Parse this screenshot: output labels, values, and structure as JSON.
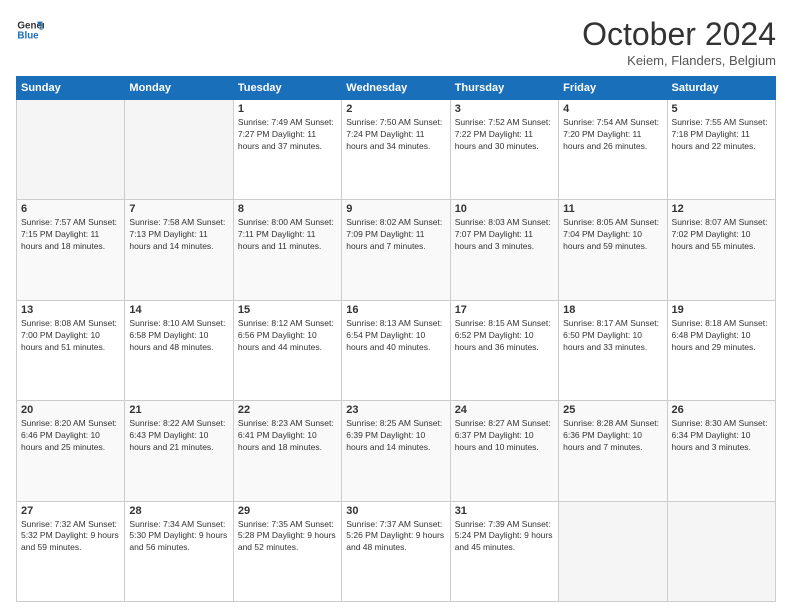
{
  "header": {
    "logo_line1": "General",
    "logo_line2": "Blue",
    "month": "October 2024",
    "location": "Keiem, Flanders, Belgium"
  },
  "weekdays": [
    "Sunday",
    "Monday",
    "Tuesday",
    "Wednesday",
    "Thursday",
    "Friday",
    "Saturday"
  ],
  "weeks": [
    [
      {
        "day": "",
        "info": ""
      },
      {
        "day": "",
        "info": ""
      },
      {
        "day": "1",
        "info": "Sunrise: 7:49 AM\nSunset: 7:27 PM\nDaylight: 11 hours\nand 37 minutes."
      },
      {
        "day": "2",
        "info": "Sunrise: 7:50 AM\nSunset: 7:24 PM\nDaylight: 11 hours\nand 34 minutes."
      },
      {
        "day": "3",
        "info": "Sunrise: 7:52 AM\nSunset: 7:22 PM\nDaylight: 11 hours\nand 30 minutes."
      },
      {
        "day": "4",
        "info": "Sunrise: 7:54 AM\nSunset: 7:20 PM\nDaylight: 11 hours\nand 26 minutes."
      },
      {
        "day": "5",
        "info": "Sunrise: 7:55 AM\nSunset: 7:18 PM\nDaylight: 11 hours\nand 22 minutes."
      }
    ],
    [
      {
        "day": "6",
        "info": "Sunrise: 7:57 AM\nSunset: 7:15 PM\nDaylight: 11 hours\nand 18 minutes."
      },
      {
        "day": "7",
        "info": "Sunrise: 7:58 AM\nSunset: 7:13 PM\nDaylight: 11 hours\nand 14 minutes."
      },
      {
        "day": "8",
        "info": "Sunrise: 8:00 AM\nSunset: 7:11 PM\nDaylight: 11 hours\nand 11 minutes."
      },
      {
        "day": "9",
        "info": "Sunrise: 8:02 AM\nSunset: 7:09 PM\nDaylight: 11 hours\nand 7 minutes."
      },
      {
        "day": "10",
        "info": "Sunrise: 8:03 AM\nSunset: 7:07 PM\nDaylight: 11 hours\nand 3 minutes."
      },
      {
        "day": "11",
        "info": "Sunrise: 8:05 AM\nSunset: 7:04 PM\nDaylight: 10 hours\nand 59 minutes."
      },
      {
        "day": "12",
        "info": "Sunrise: 8:07 AM\nSunset: 7:02 PM\nDaylight: 10 hours\nand 55 minutes."
      }
    ],
    [
      {
        "day": "13",
        "info": "Sunrise: 8:08 AM\nSunset: 7:00 PM\nDaylight: 10 hours\nand 51 minutes."
      },
      {
        "day": "14",
        "info": "Sunrise: 8:10 AM\nSunset: 6:58 PM\nDaylight: 10 hours\nand 48 minutes."
      },
      {
        "day": "15",
        "info": "Sunrise: 8:12 AM\nSunset: 6:56 PM\nDaylight: 10 hours\nand 44 minutes."
      },
      {
        "day": "16",
        "info": "Sunrise: 8:13 AM\nSunset: 6:54 PM\nDaylight: 10 hours\nand 40 minutes."
      },
      {
        "day": "17",
        "info": "Sunrise: 8:15 AM\nSunset: 6:52 PM\nDaylight: 10 hours\nand 36 minutes."
      },
      {
        "day": "18",
        "info": "Sunrise: 8:17 AM\nSunset: 6:50 PM\nDaylight: 10 hours\nand 33 minutes."
      },
      {
        "day": "19",
        "info": "Sunrise: 8:18 AM\nSunset: 6:48 PM\nDaylight: 10 hours\nand 29 minutes."
      }
    ],
    [
      {
        "day": "20",
        "info": "Sunrise: 8:20 AM\nSunset: 6:46 PM\nDaylight: 10 hours\nand 25 minutes."
      },
      {
        "day": "21",
        "info": "Sunrise: 8:22 AM\nSunset: 6:43 PM\nDaylight: 10 hours\nand 21 minutes."
      },
      {
        "day": "22",
        "info": "Sunrise: 8:23 AM\nSunset: 6:41 PM\nDaylight: 10 hours\nand 18 minutes."
      },
      {
        "day": "23",
        "info": "Sunrise: 8:25 AM\nSunset: 6:39 PM\nDaylight: 10 hours\nand 14 minutes."
      },
      {
        "day": "24",
        "info": "Sunrise: 8:27 AM\nSunset: 6:37 PM\nDaylight: 10 hours\nand 10 minutes."
      },
      {
        "day": "25",
        "info": "Sunrise: 8:28 AM\nSunset: 6:36 PM\nDaylight: 10 hours\nand 7 minutes."
      },
      {
        "day": "26",
        "info": "Sunrise: 8:30 AM\nSunset: 6:34 PM\nDaylight: 10 hours\nand 3 minutes."
      }
    ],
    [
      {
        "day": "27",
        "info": "Sunrise: 7:32 AM\nSunset: 5:32 PM\nDaylight: 9 hours\nand 59 minutes."
      },
      {
        "day": "28",
        "info": "Sunrise: 7:34 AM\nSunset: 5:30 PM\nDaylight: 9 hours\nand 56 minutes."
      },
      {
        "day": "29",
        "info": "Sunrise: 7:35 AM\nSunset: 5:28 PM\nDaylight: 9 hours\nand 52 minutes."
      },
      {
        "day": "30",
        "info": "Sunrise: 7:37 AM\nSunset: 5:26 PM\nDaylight: 9 hours\nand 48 minutes."
      },
      {
        "day": "31",
        "info": "Sunrise: 7:39 AM\nSunset: 5:24 PM\nDaylight: 9 hours\nand 45 minutes."
      },
      {
        "day": "",
        "info": ""
      },
      {
        "day": "",
        "info": ""
      }
    ]
  ]
}
